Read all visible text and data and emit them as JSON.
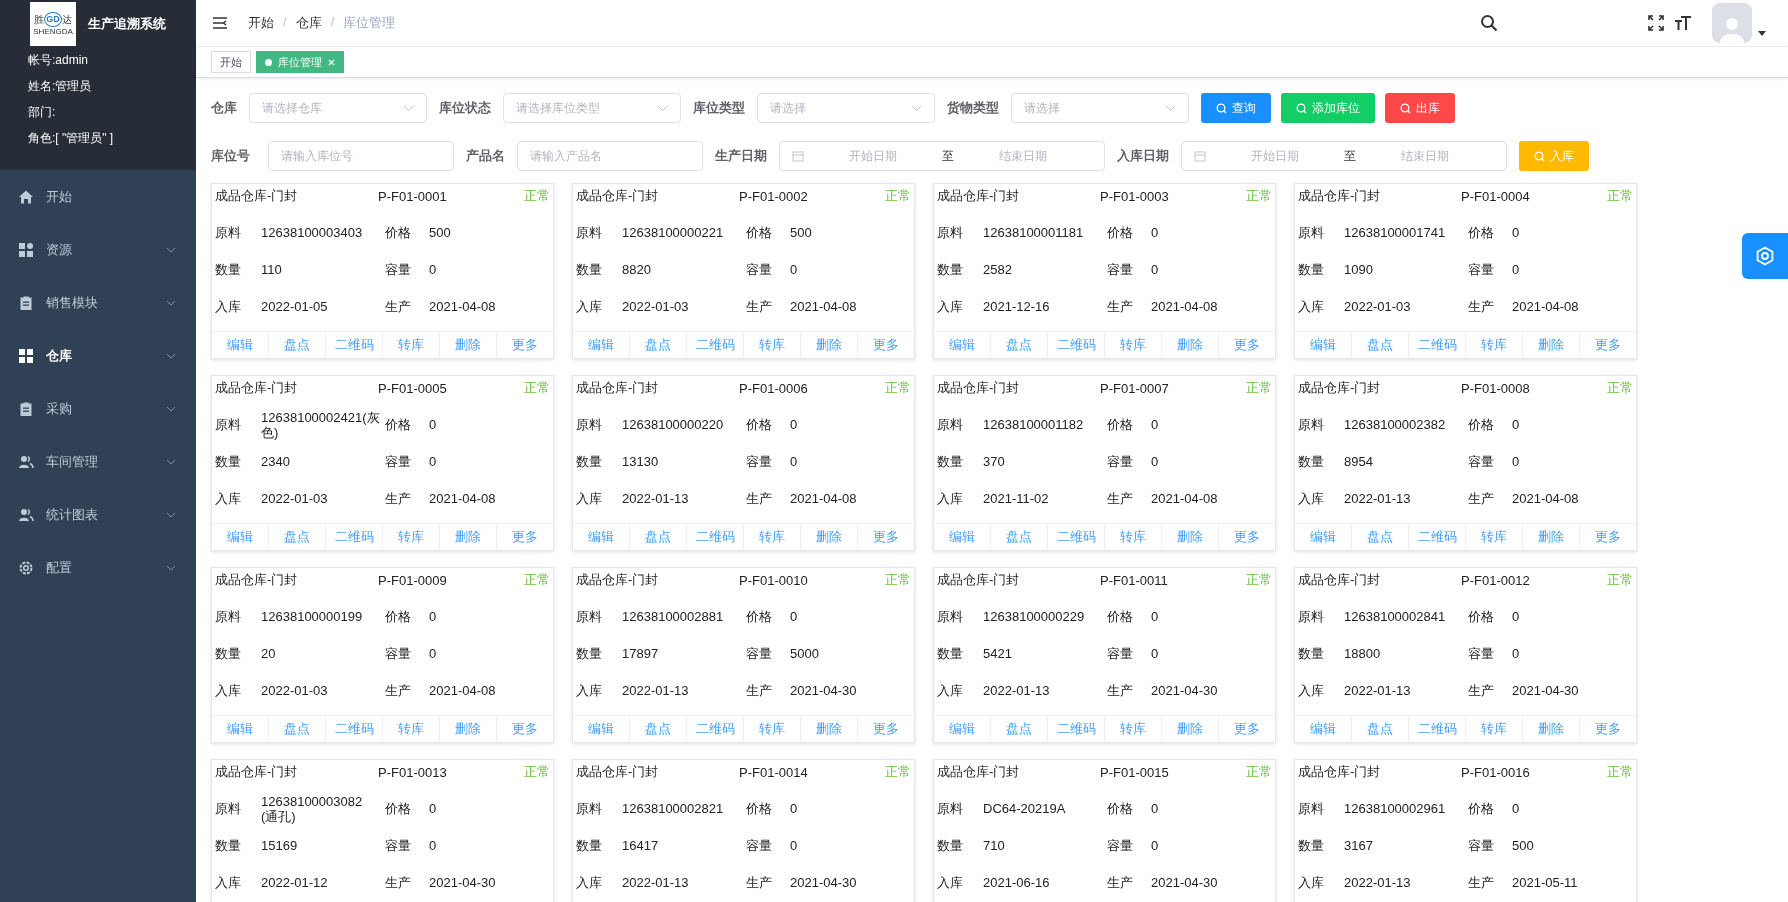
{
  "sidebar": {
    "logo": {
      "left": "胜",
      "mark": "GD",
      "right": "达",
      "caption": "SHENGDA"
    },
    "app_title": "生产追溯系统",
    "user_info": [
      "帐号:admin",
      "姓名:管理员",
      "部门:",
      "角色:[ \"管理员\" ]"
    ],
    "items": [
      {
        "label": "开始",
        "selected": false,
        "submenu": false
      },
      {
        "label": "资源",
        "selected": false,
        "submenu": true
      },
      {
        "label": "销售模块",
        "selected": false,
        "submenu": true
      },
      {
        "label": "仓库",
        "selected": true,
        "submenu": true
      },
      {
        "label": "采购",
        "selected": false,
        "submenu": true
      },
      {
        "label": "车间管理",
        "selected": false,
        "submenu": true
      },
      {
        "label": "统计图表",
        "selected": false,
        "submenu": true
      },
      {
        "label": "配置",
        "selected": false,
        "submenu": true
      }
    ]
  },
  "breadcrumb": {
    "items": [
      "开始",
      "仓库",
      "库位管理"
    ],
    "separators": [
      "/",
      "/"
    ]
  },
  "tags": [
    {
      "label": "开始",
      "selected": false,
      "closable": false
    },
    {
      "label": "库位管理",
      "selected": true,
      "closable": true
    }
  ],
  "filters": [
    [
      {
        "kind": "select",
        "label": "仓库",
        "placeholder": "请选择仓库"
      },
      {
        "kind": "select",
        "label": "库位状态",
        "placeholder": "请选择库位类型"
      },
      {
        "kind": "select",
        "label": "库位类型",
        "placeholder": "请选择"
      },
      {
        "kind": "select",
        "label": "货物类型",
        "placeholder": "请选择"
      },
      {
        "kind": "button",
        "label": "查询",
        "color": "#1890ff"
      },
      {
        "kind": "button",
        "label": "添加库位",
        "color": "#13ce66"
      },
      {
        "kind": "button",
        "label": "出库",
        "color": "#ff4949"
      }
    ],
    [
      {
        "kind": "input",
        "label": "库位号",
        "placeholder": "请输入库位号"
      },
      {
        "kind": "input",
        "label": "产品名",
        "placeholder": "请输入产品名"
      },
      {
        "kind": "daterange",
        "label": "生产日期",
        "start": "开始日期",
        "sep": "至",
        "end": "结束日期"
      },
      {
        "kind": "daterange",
        "label": "入库日期",
        "start": "开始日期",
        "sep": "至",
        "end": "结束日期"
      },
      {
        "kind": "button",
        "label": "入库",
        "color": "#ffba00"
      }
    ]
  ],
  "cards": [
    {
      "title": "成品仓库-门封",
      "code": "P-F01-0001",
      "status": "正常",
      "fields": [
        [
          "原料",
          "12638100003403"
        ],
        [
          "价格",
          "500"
        ],
        [
          "数量",
          "110"
        ],
        [
          "容量",
          "0"
        ],
        [
          "入库",
          "2022-01-05"
        ],
        [
          "生产",
          "2021-04-08"
        ]
      ],
      "actions": [
        "编辑",
        "盘点",
        "二维码",
        "转库",
        "删除",
        "更多"
      ]
    },
    {
      "title": "成品仓库-门封",
      "code": "P-F01-0002",
      "status": "正常",
      "fields": [
        [
          "原料",
          "12638100000221"
        ],
        [
          "价格",
          "500"
        ],
        [
          "数量",
          "8820"
        ],
        [
          "容量",
          "0"
        ],
        [
          "入库",
          "2022-01-03"
        ],
        [
          "生产",
          "2021-04-08"
        ]
      ],
      "actions": [
        "编辑",
        "盘点",
        "二维码",
        "转库",
        "删除",
        "更多"
      ]
    },
    {
      "title": "成品仓库-门封",
      "code": "P-F01-0003",
      "status": "正常",
      "fields": [
        [
          "原料",
          "12638100001181"
        ],
        [
          "价格",
          "0"
        ],
        [
          "数量",
          "2582"
        ],
        [
          "容量",
          "0"
        ],
        [
          "入库",
          "2021-12-16"
        ],
        [
          "生产",
          "2021-04-08"
        ]
      ],
      "actions": [
        "编辑",
        "盘点",
        "二维码",
        "转库",
        "删除",
        "更多"
      ]
    },
    {
      "title": "成品仓库-门封",
      "code": "P-F01-0004",
      "status": "正常",
      "fields": [
        [
          "原料",
          "12638100001741"
        ],
        [
          "价格",
          "0"
        ],
        [
          "数量",
          "1090"
        ],
        [
          "容量",
          "0"
        ],
        [
          "入库",
          "2022-01-03"
        ],
        [
          "生产",
          "2021-04-08"
        ]
      ],
      "actions": [
        "编辑",
        "盘点",
        "二维码",
        "转库",
        "删除",
        "更多"
      ]
    },
    {
      "title": "成品仓库-门封",
      "code": "P-F01-0005",
      "status": "正常",
      "fields": [
        [
          "原料",
          "12638100002421(灰色)"
        ],
        [
          "价格",
          "0"
        ],
        [
          "数量",
          "2340"
        ],
        [
          "容量",
          "0"
        ],
        [
          "入库",
          "2022-01-03"
        ],
        [
          "生产",
          "2021-04-08"
        ]
      ],
      "actions": [
        "编辑",
        "盘点",
        "二维码",
        "转库",
        "删除",
        "更多"
      ]
    },
    {
      "title": "成品仓库-门封",
      "code": "P-F01-0006",
      "status": "正常",
      "fields": [
        [
          "原料",
          "12638100000220"
        ],
        [
          "价格",
          "0"
        ],
        [
          "数量",
          "13130"
        ],
        [
          "容量",
          "0"
        ],
        [
          "入库",
          "2022-01-13"
        ],
        [
          "生产",
          "2021-04-08"
        ]
      ],
      "actions": [
        "编辑",
        "盘点",
        "二维码",
        "转库",
        "删除",
        "更多"
      ]
    },
    {
      "title": "成品仓库-门封",
      "code": "P-F01-0007",
      "status": "正常",
      "fields": [
        [
          "原料",
          "12638100001182"
        ],
        [
          "价格",
          "0"
        ],
        [
          "数量",
          "370"
        ],
        [
          "容量",
          "0"
        ],
        [
          "入库",
          "2021-11-02"
        ],
        [
          "生产",
          "2021-04-08"
        ]
      ],
      "actions": [
        "编辑",
        "盘点",
        "二维码",
        "转库",
        "删除",
        "更多"
      ]
    },
    {
      "title": "成品仓库-门封",
      "code": "P-F01-0008",
      "status": "正常",
      "fields": [
        [
          "原料",
          "12638100002382"
        ],
        [
          "价格",
          "0"
        ],
        [
          "数量",
          "8954"
        ],
        [
          "容量",
          "0"
        ],
        [
          "入库",
          "2022-01-13"
        ],
        [
          "生产",
          "2021-04-08"
        ]
      ],
      "actions": [
        "编辑",
        "盘点",
        "二维码",
        "转库",
        "删除",
        "更多"
      ]
    },
    {
      "title": "成品仓库-门封",
      "code": "P-F01-0009",
      "status": "正常",
      "fields": [
        [
          "原料",
          "12638100000199"
        ],
        [
          "价格",
          "0"
        ],
        [
          "数量",
          "20"
        ],
        [
          "容量",
          "0"
        ],
        [
          "入库",
          "2022-01-03"
        ],
        [
          "生产",
          "2021-04-08"
        ]
      ],
      "actions": [
        "编辑",
        "盘点",
        "二维码",
        "转库",
        "删除",
        "更多"
      ]
    },
    {
      "title": "成品仓库-门封",
      "code": "P-F01-0010",
      "status": "正常",
      "fields": [
        [
          "原料",
          "12638100002881"
        ],
        [
          "价格",
          "0"
        ],
        [
          "数量",
          "17897"
        ],
        [
          "容量",
          "5000"
        ],
        [
          "入库",
          "2022-01-13"
        ],
        [
          "生产",
          "2021-04-30"
        ]
      ],
      "actions": [
        "编辑",
        "盘点",
        "二维码",
        "转库",
        "删除",
        "更多"
      ]
    },
    {
      "title": "成品仓库-门封",
      "code": "P-F01-0011",
      "status": "正常",
      "fields": [
        [
          "原料",
          "12638100000229"
        ],
        [
          "价格",
          "0"
        ],
        [
          "数量",
          "5421"
        ],
        [
          "容量",
          "0"
        ],
        [
          "入库",
          "2022-01-13"
        ],
        [
          "生产",
          "2021-04-30"
        ]
      ],
      "actions": [
        "编辑",
        "盘点",
        "二维码",
        "转库",
        "删除",
        "更多"
      ]
    },
    {
      "title": "成品仓库-门封",
      "code": "P-F01-0012",
      "status": "正常",
      "fields": [
        [
          "原料",
          "12638100002841"
        ],
        [
          "价格",
          "0"
        ],
        [
          "数量",
          "18800"
        ],
        [
          "容量",
          "0"
        ],
        [
          "入库",
          "2022-01-13"
        ],
        [
          "生产",
          "2021-04-30"
        ]
      ],
      "actions": [
        "编辑",
        "盘点",
        "二维码",
        "转库",
        "删除",
        "更多"
      ]
    },
    {
      "title": "成品仓库-门封",
      "code": "P-F01-0013",
      "status": "正常",
      "fields": [
        [
          "原料",
          "12638100003082 (通孔)"
        ],
        [
          "价格",
          "0"
        ],
        [
          "数量",
          "15169"
        ],
        [
          "容量",
          "0"
        ],
        [
          "入库",
          "2022-01-12"
        ],
        [
          "生产",
          "2021-04-30"
        ]
      ]
    },
    {
      "title": "成品仓库-门封",
      "code": "P-F01-0014",
      "status": "正常",
      "fields": [
        [
          "原料",
          "12638100002821"
        ],
        [
          "价格",
          "0"
        ],
        [
          "数量",
          "16417"
        ],
        [
          "容量",
          "0"
        ],
        [
          "入库",
          "2022-01-13"
        ],
        [
          "生产",
          "2021-04-30"
        ]
      ]
    },
    {
      "title": "成品仓库-门封",
      "code": "P-F01-0015",
      "status": "正常",
      "fields": [
        [
          "原料",
          "DC64-20219A"
        ],
        [
          "价格",
          "0"
        ],
        [
          "数量",
          "710"
        ],
        [
          "容量",
          "0"
        ],
        [
          "入库",
          "2021-06-16"
        ],
        [
          "生产",
          "2021-04-30"
        ]
      ]
    },
    {
      "title": "成品仓库-门封",
      "code": "P-F01-0016",
      "status": "正常",
      "fields": [
        [
          "原料",
          "12638100002961"
        ],
        [
          "价格",
          "0"
        ],
        [
          "数量",
          "3167"
        ],
        [
          "容量",
          "500"
        ],
        [
          "入库",
          "2022-01-13"
        ],
        [
          "生产",
          "2021-05-11"
        ]
      ]
    }
  ]
}
